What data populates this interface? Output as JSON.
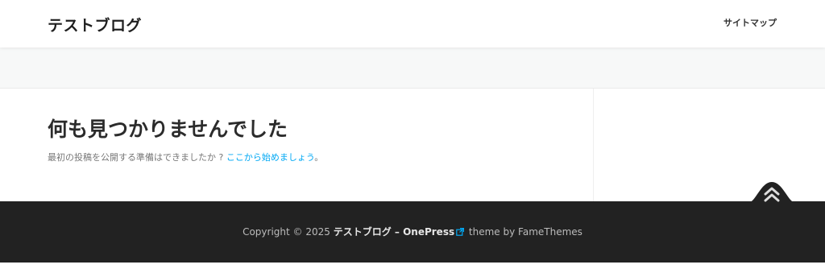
{
  "header": {
    "site_title": "テストブログ",
    "nav": [
      {
        "label": "サイトマップ"
      }
    ]
  },
  "main": {
    "title": "何も見つかりませんでした",
    "description": "最初の投稿を公開する準備はできましたか ? ",
    "link_text": "ここから始めましょう",
    "suffix": "。"
  },
  "footer": {
    "copyright_prefix": "Copyright © 2025 ",
    "site_name": "テストブログ",
    "dash": " – ",
    "theme_name": "OnePress",
    "theme_suffix": " theme by FameThemes"
  },
  "icons": {
    "external_link": "external-link-icon",
    "back_to_top": "double-chevron-up-icon"
  },
  "colors": {
    "link": "#03a9f4",
    "footer_bg": "#222222",
    "band_bg": "#f7f8f8"
  }
}
